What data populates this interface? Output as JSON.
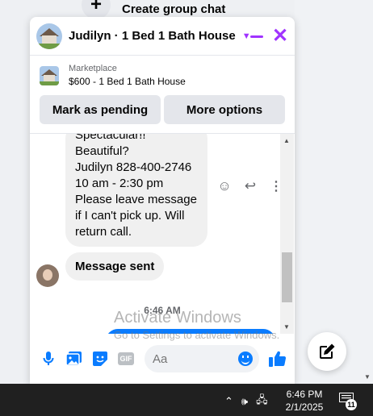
{
  "background": {
    "create_group_label": "Create group chat",
    "create_group_icon": "plus-icon"
  },
  "chat": {
    "title": "Judilyn · 1 Bed 1 Bath House",
    "accent_color": "#a033ff",
    "listing": {
      "label": "Marketplace",
      "detail": "$600 - 1 Bed 1 Bath House",
      "buttons": [
        "Mark as pending",
        "More options"
      ]
    },
    "messages": [
      {
        "text": "Spectacular!!\nBeautiful?\nJudilyn 828-400-2746\n10 am - 2:30 pm\nPlease leave message if I can't pick up. Will return call.",
        "sender": "other"
      },
      {
        "text": "Message sent",
        "sender": "other"
      }
    ],
    "timestamp": "6:46 AM",
    "composer": {
      "placeholder": "Aa",
      "icons": [
        "microphone-icon",
        "photo-icon",
        "sticker-icon",
        "gif-icon",
        "emoji-icon",
        "like-icon"
      ],
      "gif_label": "GIF"
    }
  },
  "watermark": {
    "title": "Activate Windows",
    "subtitle": "Go to Settings to activate Windows."
  },
  "taskbar": {
    "time": "6:46 PM",
    "date": "2/1/2025",
    "notification_count": "11"
  }
}
